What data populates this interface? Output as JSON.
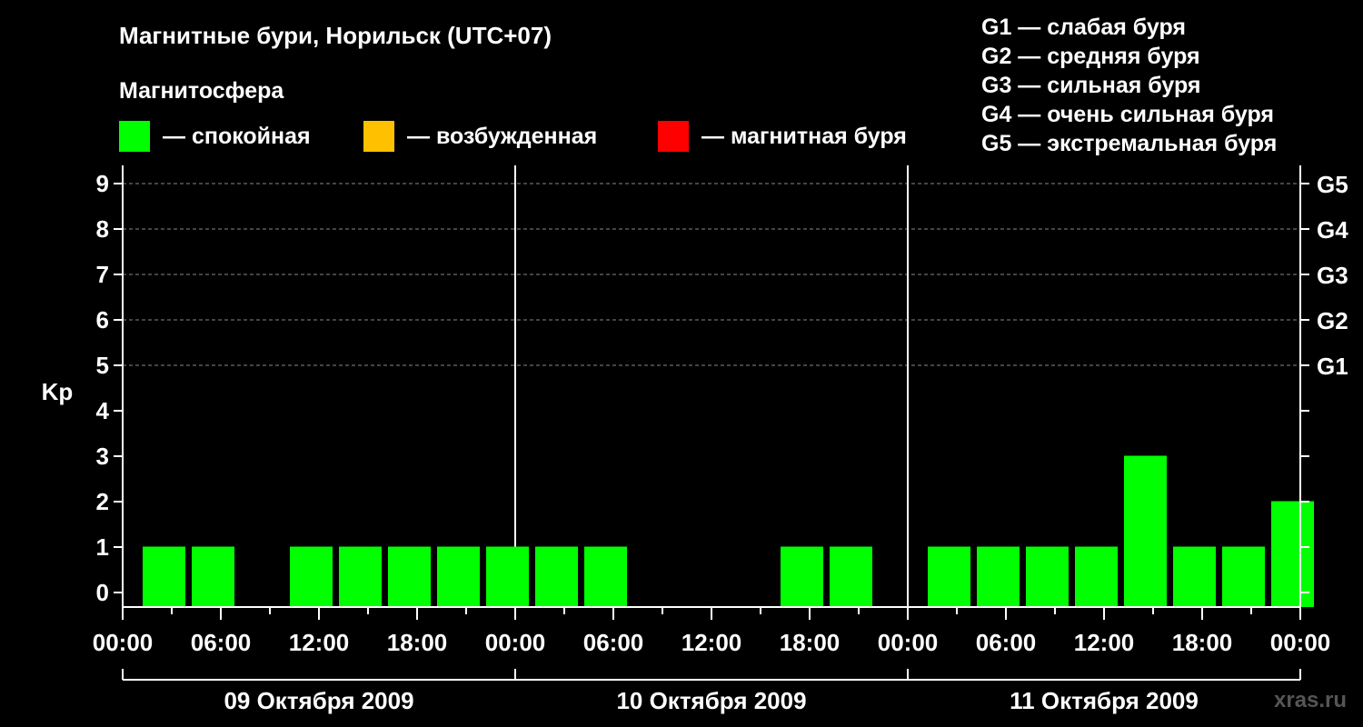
{
  "title": "Магнитные бури, Норильск (UTC+07)",
  "subtitle": "Магнитосфера",
  "legend": [
    {
      "label": "— спокойная",
      "color": "#00ff00"
    },
    {
      "label": "— возбужденная",
      "color": "#ffc000"
    },
    {
      "label": "— магнитная буря",
      "color": "#ff0000"
    }
  ],
  "g_scale": [
    "G1 — слабая буря",
    "G2 — средняя буря",
    "G3 — сильная буря",
    "G4 — очень сильная буря",
    "G5 — экстремальная буря"
  ],
  "watermark": "xras.ru",
  "chart_data": {
    "type": "bar",
    "ylabel": "Kp",
    "ylim": [
      0,
      9
    ],
    "y_ticks": [
      "0",
      "1",
      "2",
      "3",
      "4",
      "5",
      "6",
      "7",
      "8",
      "9"
    ],
    "right_ticks": [
      {
        "y": 5,
        "label": "G1"
      },
      {
        "y": 6,
        "label": "G2"
      },
      {
        "y": 7,
        "label": "G3"
      },
      {
        "y": 8,
        "label": "G4"
      },
      {
        "y": 9,
        "label": "G5"
      }
    ],
    "x_tick_labels": [
      "00:00",
      "06:00",
      "12:00",
      "18:00",
      "00:00",
      "06:00",
      "12:00",
      "18:00",
      "00:00",
      "06:00",
      "12:00",
      "18:00",
      "00:00"
    ],
    "days": [
      "09 Октября 2009",
      "10 Октября 2009",
      "11 Октября 2009"
    ],
    "grid": "dashed horizontal",
    "color_quiet": "#00ff00",
    "values": [
      1,
      1,
      0,
      1,
      1,
      1,
      1,
      1,
      1,
      1,
      0,
      0,
      0,
      1,
      1,
      0,
      1,
      1,
      1,
      1,
      3,
      1,
      1,
      2
    ]
  }
}
